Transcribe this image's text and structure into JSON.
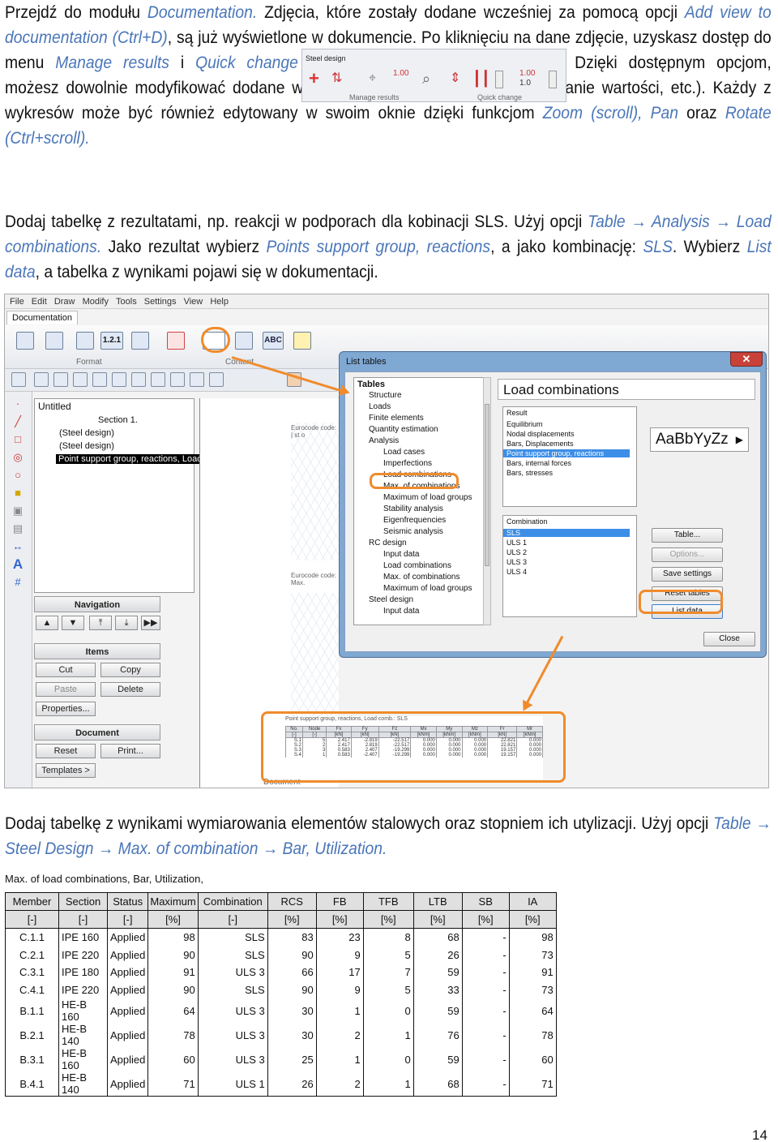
{
  "para1": {
    "t1": "Przejdź do modułu ",
    "h1": "Documentation.",
    "t2": " Zdjęcia, które zostały dodane wcześniej za pomocą opcji ",
    "h2": "Add view to documentation (Ctrl+D)",
    "t3": ", są już wyświetlone w dokumencie. Po kliknięciu na dane zdjęcie, uzyskasz dostęp do menu ",
    "h3": "Manage results",
    "t4": " i ",
    "h4": "Quick change",
    "t5": ". Dzięki dostępnym opcjom, możesz dowolnie modyfikować dodane wcześniej rezultaty (zmiana skali, dodanie wartości, etc.). Każdy z wykresów może być również edytowany w swoim oknie dzięki funkcjom ",
    "h5": "Zoom (scroll), Pan",
    "t6": " oraz ",
    "h6": "Rotate (Ctrl+scroll)."
  },
  "inline_toolbar": {
    "title": "Steel design",
    "label_left": "Manage results",
    "label_right": "Quick change",
    "val1": "1.00",
    "val2": "1.00",
    "val3": "1.0"
  },
  "para2": {
    "t1": "Dodaj tabelkę z rezultatami, np. reakcji w podporach dla kobinacji SLS. Użyj opcji ",
    "h1": "Table → Analysis → Load combinations.",
    "t2": " Jako rezultat wybierz ",
    "h2": "Points support group, reactions",
    "t3": ", a jako kombinację: ",
    "h3": "SLS",
    "t4": ". Wybierz ",
    "h4": "List data",
    "t5": ", a tabelka z wynikami pojawi się w dokumentacji."
  },
  "app": {
    "menu": [
      "File",
      "Edit",
      "Draw",
      "Modify",
      "Tools",
      "Settings",
      "View",
      "Help"
    ],
    "tab": "Documentation",
    "ribbon_groups": [
      "Format",
      "Content"
    ],
    "ribbon_numbers": "1.2.1",
    "abc": "ABC",
    "tree": {
      "root": "Untitled",
      "section": "Section 1.",
      "item1": "(Steel design)",
      "item2": "(Steel design)",
      "item3": "Point support group, reactions, Load co"
    },
    "panels": {
      "navigation": "Navigation",
      "items": "Items",
      "cut": "Cut",
      "copy": "Copy",
      "paste": "Paste",
      "delete": "Delete",
      "properties": "Properties...",
      "document": "Document",
      "reset": "Reset",
      "print": "Print...",
      "templates": "Templates >"
    },
    "canvas_labels": {
      "eurocode1": "Eurocode code: | st o",
      "eurocode2": "Eurocode code: Max.",
      "result_caption": "Point support group, reactions, Load comb.: SLS",
      "doc": "Document"
    }
  },
  "dialog": {
    "title": "List tables",
    "tables_label": "Tables",
    "tree": [
      "Structure",
      "Loads",
      "Finite elements",
      "Quantity estimation",
      "Analysis",
      "Load cases",
      "Imperfections",
      "Load combinations",
      "Max. of combinations",
      "Maximum of load groups",
      "Stability analysis",
      "Eigenfrequencies",
      "Seismic analysis",
      "RC design",
      "Input data",
      "Load combinations",
      "Max. of combinations",
      "Maximum of load groups",
      "Steel design",
      "Input data"
    ],
    "heading": "Load combinations",
    "result_label": "Result",
    "results": [
      "Equilibrium",
      "Nodal displacements",
      "Bars, Displacements",
      "Point support group, reactions",
      "Bars, internal forces",
      "Bars, stresses"
    ],
    "combination_label": "Combination",
    "combinations": [
      "SLS",
      "ULS 1",
      "ULS 2",
      "ULS 3",
      "ULS 4"
    ],
    "style_sample": "AaBbYyZz",
    "buttons": {
      "table": "Table...",
      "options": "Options...",
      "save": "Save settings",
      "reset": "Reset tables",
      "list": "List data",
      "close": "Close"
    }
  },
  "mini_table": {
    "headers": [
      "No.",
      "Node",
      "Fx",
      "Fy",
      "Fz",
      "Mx",
      "My",
      "Mz",
      "Fr",
      "Mr"
    ],
    "units": [
      "[-]",
      "[-]",
      "[kN]",
      "[kN]",
      "[kN]",
      "[kNm]",
      "[kNm]",
      "[kNm]",
      "[kN]",
      "[kNm]"
    ],
    "rows": [
      [
        "S.1",
        "5",
        "2.417",
        "-2.819",
        "-22.517",
        "0.000",
        "0.000",
        "0.000",
        "22.821",
        "0.000"
      ],
      [
        "S.2",
        "2",
        "2.417",
        "2.819",
        "-22.517",
        "0.000",
        "0.000",
        "0.000",
        "22.821",
        "0.000"
      ],
      [
        "S.3",
        "3",
        "0.583",
        "2.407",
        "-19.299",
        "0.000",
        "0.000",
        "0.000",
        "19.157",
        "0.000"
      ],
      [
        "S.4",
        "1",
        "0.583",
        "-2.407",
        "-19.299",
        "0.000",
        "0.000",
        "0.000",
        "19.157",
        "0.000"
      ]
    ]
  },
  "para3": {
    "t1": "Dodaj tabelkę z wynikami wymiarowania elementów stalowych oraz stopniem ich utylizacji. Użyj opcji ",
    "h1": "Table → Steel Design → Max. of combination → Bar, Utilization."
  },
  "results_table": {
    "caption": "Max. of load combinations, Bar, Utilization,",
    "headers": [
      "Member",
      "Section",
      "Status",
      "Maximum",
      "Combination",
      "RCS",
      "FB",
      "TFB",
      "LTB",
      "SB",
      "IA"
    ],
    "units": [
      "[-]",
      "[-]",
      "[-]",
      "[%]",
      "[-]",
      "[%]",
      "[%]",
      "[%]",
      "[%]",
      "[%]",
      "[%]"
    ],
    "rows": [
      [
        "C.1.1",
        "IPE 160",
        "Applied",
        "98",
        "SLS",
        "83",
        "23",
        "8",
        "68",
        "-",
        "98"
      ],
      [
        "C.2.1",
        "IPE 220",
        "Applied",
        "90",
        "SLS",
        "90",
        "9",
        "5",
        "26",
        "-",
        "73"
      ],
      [
        "C.3.1",
        "IPE 180",
        "Applied",
        "91",
        "ULS 3",
        "66",
        "17",
        "7",
        "59",
        "-",
        "91"
      ],
      [
        "C.4.1",
        "IPE 220",
        "Applied",
        "90",
        "SLS",
        "90",
        "9",
        "5",
        "33",
        "-",
        "73"
      ],
      [
        "B.1.1",
        "HE-B 160",
        "Applied",
        "64",
        "ULS 3",
        "30",
        "1",
        "0",
        "59",
        "-",
        "64"
      ],
      [
        "B.2.1",
        "HE-B 140",
        "Applied",
        "78",
        "ULS 3",
        "30",
        "2",
        "1",
        "76",
        "-",
        "78"
      ],
      [
        "B.3.1",
        "HE-B 160",
        "Applied",
        "60",
        "ULS 3",
        "25",
        "1",
        "0",
        "59",
        "-",
        "60"
      ],
      [
        "B.4.1",
        "HE-B 140",
        "Applied",
        "71",
        "ULS 1",
        "26",
        "2",
        "1",
        "68",
        "-",
        "71"
      ]
    ]
  },
  "page_number": "14",
  "colors": {
    "highlight_text": "#4a76b8",
    "annotation": "#f08b2c",
    "dialog_frame": "#7fa8d3",
    "selection": "#3d8ee6"
  }
}
